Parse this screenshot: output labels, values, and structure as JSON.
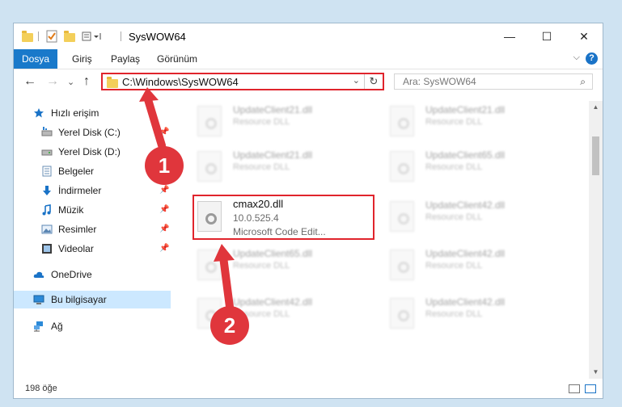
{
  "window": {
    "title": "SysWOW64",
    "controls": {
      "minimize": "—",
      "maximize": "☐",
      "close": "✕"
    }
  },
  "ribbon": {
    "tabs": [
      {
        "label": "Dosya",
        "active": true
      },
      {
        "label": "Giriş"
      },
      {
        "label": "Paylaş"
      },
      {
        "label": "Görünüm"
      }
    ],
    "help": "?",
    "collapse": "⌵"
  },
  "nav": {
    "back": "←",
    "forward": "→",
    "recent": "⌄",
    "up": "↑",
    "address": "C:\\Windows\\SysWOW64",
    "address_dropdown": "⌄",
    "refresh": "↻",
    "search_placeholder": "Ara: SysWOW64",
    "search_icon": "⌕"
  },
  "sidebar": {
    "items": [
      {
        "label": "Hızlı erişim",
        "icon": "star-icon",
        "pin": ""
      },
      {
        "label": "Yerel Disk (C:)",
        "icon": "drive-icon",
        "pin": "📌"
      },
      {
        "label": "Yerel Disk (D:)",
        "icon": "drive-icon",
        "pin": "📌"
      },
      {
        "label": "Belgeler",
        "icon": "document-icon",
        "pin": "📌"
      },
      {
        "label": "İndirmeler",
        "icon": "download-icon",
        "pin": "📌"
      },
      {
        "label": "Müzik",
        "icon": "music-icon",
        "pin": "📌"
      },
      {
        "label": "Resimler",
        "icon": "picture-icon",
        "pin": "📌"
      },
      {
        "label": "Videolar",
        "icon": "video-icon",
        "pin": "📌"
      },
      {
        "label": "OneDrive",
        "icon": "cloud-icon",
        "pin": ""
      },
      {
        "label": "Bu bilgisayar",
        "icon": "computer-icon",
        "pin": "",
        "selected": true
      },
      {
        "label": "Ağ",
        "icon": "network-icon",
        "pin": ""
      }
    ]
  },
  "files": {
    "left": [
      {
        "name": "UpdateClient21.dll",
        "type": "Resource DLL"
      },
      {
        "name": "UpdateClient21.dll",
        "type": "Resource DLL"
      },
      {
        "name": "UpdateClient65.dll",
        "type": "Resource DLL"
      },
      {
        "name": "UpdateClient42.dll",
        "type": "Resource DLL"
      }
    ],
    "right": [
      {
        "name": "UpdateClient21.dll",
        "type": "Resource DLL"
      },
      {
        "name": "UpdateClient65.dll",
        "type": "Resource DLL"
      },
      {
        "name": "UpdateClient42.dll",
        "type": "Resource DLL"
      },
      {
        "name": "UpdateClient42.dll",
        "type": "Resource DLL"
      },
      {
        "name": "UpdateClient42.dll",
        "type": "Resource DLL"
      }
    ],
    "selected": {
      "name": "cmax20.dll",
      "version": "10.0.525.4",
      "description": "Microsoft Code Edit..."
    }
  },
  "status": {
    "count": "198 öğe"
  },
  "annotations": {
    "step1": "1",
    "step2": "2"
  },
  "colors": {
    "accent": "#1979ca",
    "highlight": "#e0242c",
    "selected_bg": "#cce8ff"
  }
}
